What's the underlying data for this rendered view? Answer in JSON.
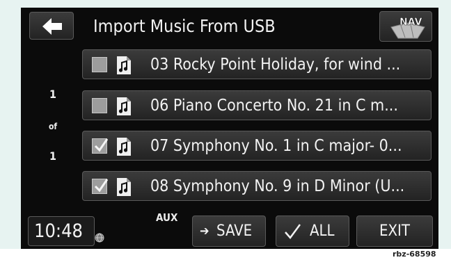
{
  "header": {
    "title": "Import Music From USB",
    "nav_label": "NAV"
  },
  "tracks": [
    {
      "label": "03 Rocky Point Holiday, for wind ...",
      "checked": false
    },
    {
      "label": "06 Piano Concerto No. 21 in C m...",
      "checked": false
    },
    {
      "label": "07 Symphony No. 1 in C major- 0...",
      "checked": true
    },
    {
      "label": "08 Symphony No. 9 in D Minor  (U...",
      "checked": true
    }
  ],
  "pagination": {
    "current": "1",
    "of": "of",
    "total": "1"
  },
  "footer": {
    "time": "10:48",
    "source": "AUX",
    "save_label": "SAVE",
    "all_label": "ALL",
    "exit_label": "EXIT"
  },
  "image_tag": "rbz-68598",
  "colors": {
    "background": "#0b0b0b",
    "button": "#2e2e2e",
    "text": "#f2f2f2",
    "checkbox": "#9d9d9d"
  }
}
